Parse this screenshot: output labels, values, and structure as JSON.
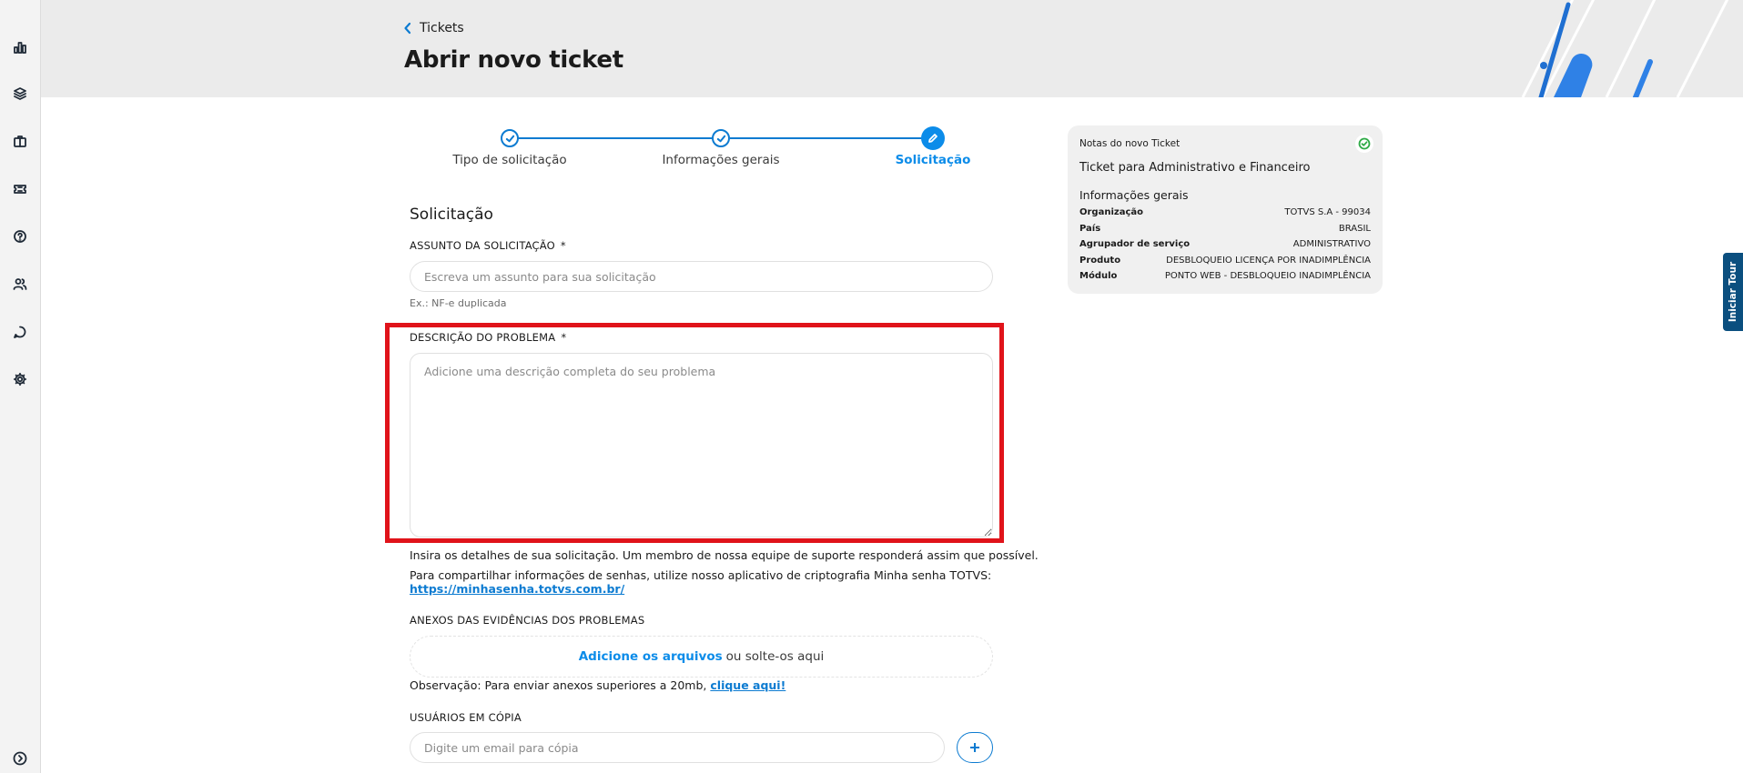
{
  "header": {
    "back_label": "Tickets",
    "title": "Abrir novo ticket"
  },
  "stepper": {
    "steps": [
      {
        "label": "Tipo de solicitação",
        "state": "done"
      },
      {
        "label": "Informações gerais",
        "state": "done"
      },
      {
        "label": "Solicitação",
        "state": "active"
      }
    ]
  },
  "form": {
    "section_title": "Solicitação",
    "subject": {
      "label": "ASSUNTO DA SOLICITAÇÃO",
      "required_mark": "*",
      "placeholder": "Escreva um assunto para sua solicitação",
      "value": "",
      "hint": "Ex.: NF-e duplicada"
    },
    "description": {
      "label": "DESCRIÇÃO DO PROBLEMA",
      "required_mark": "*",
      "placeholder": "Adicione uma descrição completa do seu problema",
      "value": ""
    },
    "info_line1": "Insira os detalhes de sua solicitação. Um membro de nossa equipe de suporte responderá assim que possível.",
    "info_line2": "Para compartilhar informações de senhas, utilize nosso aplicativo de criptografia Minha senha TOTVS:",
    "info_link": "https://minhasenha.totvs.com.br/",
    "attachments": {
      "label": "ANEXOS DAS EVIDÊNCIAS DOS PROBLEMAS",
      "add_link": "Adicione os arquivos",
      "add_rest": "ou solte-os aqui",
      "note": "Observação: Para enviar anexos superiores a 20mb,",
      "note_link": "clique aqui!"
    },
    "cc": {
      "label": "USUÁRIOS EM CÓPIA",
      "placeholder": "Digite um email para cópia",
      "value": ""
    }
  },
  "card": {
    "heading": "Notas do novo Ticket",
    "title": "Ticket para Administrativo e Financeiro",
    "subtitle": "Informações gerais",
    "rows": [
      {
        "key": "Organização",
        "value": "TOTVS S.A - 99034"
      },
      {
        "key": "País",
        "value": "BRASIL"
      },
      {
        "key": "Agrupador de serviço",
        "value": "ADMINISTRATIVO"
      },
      {
        "key": "Produto",
        "value": "DESBLOQUEIO LICENÇA POR INADIMPLÊNCIA"
      },
      {
        "key": "Módulo",
        "value": "PONTO WEB - DESBLOQUEIO INADIMPLÊNCIA"
      }
    ]
  },
  "tour_label": "Iniciar Tour",
  "colors": {
    "accent": "#0c8ce9",
    "highlight": "#e0131a",
    "tour": "#0b4f7f",
    "success": "#2eaa46"
  },
  "sidebar_icons": [
    "chart-icon",
    "layers-icon",
    "briefcase-icon",
    "ticket-icon",
    "help-icon",
    "users-icon",
    "chat-icon",
    "gear-icon",
    "expand-icon"
  ]
}
